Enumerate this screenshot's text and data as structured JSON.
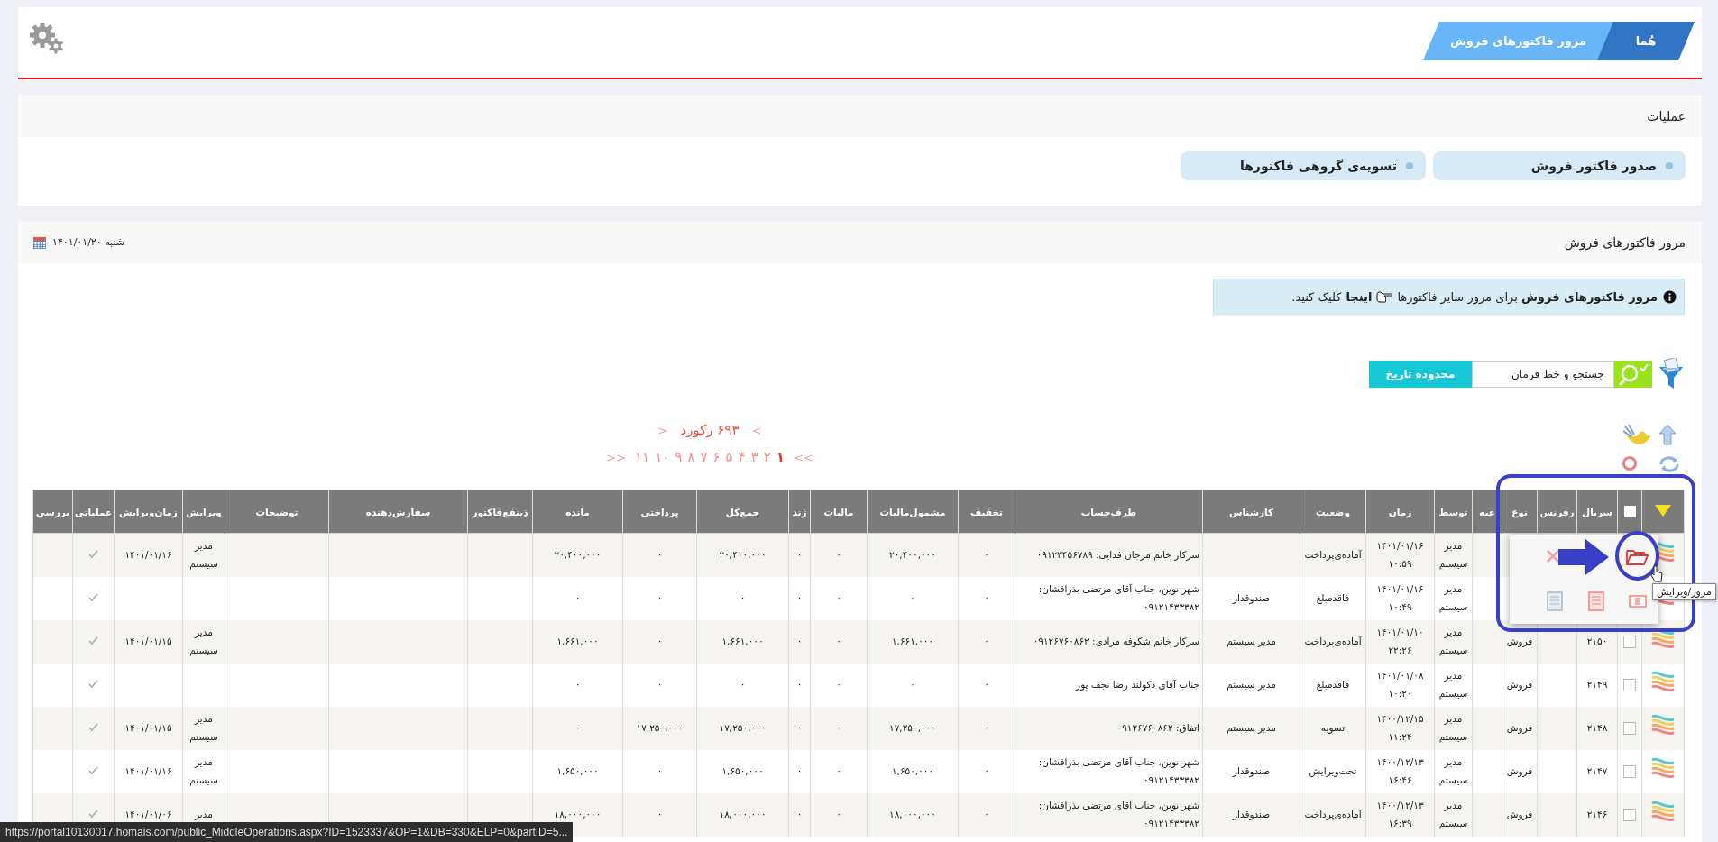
{
  "breadcrumb": [
    {
      "label": "هُما",
      "kind": "home"
    },
    {
      "label": "مرور فاکتورهای فروش",
      "kind": "page"
    }
  ],
  "operations": {
    "title": "عملیات",
    "buttons": [
      "صدور فاکتور فروش",
      "تسویه‌ی گروهی فاکتورها"
    ]
  },
  "invoices": {
    "title": "مرور فاکتورهای فروش",
    "date": "شنبه ۱۴۰۱/۰۱/۲۰",
    "notice": {
      "text": "**مرور فاکتورهای فروش** برای مرور سایر فاکتورها",
      "link": "اینجا",
      "tail": "کلیک کنید."
    },
    "search": {
      "placeholder": "جستجو و خط فرمان"
    },
    "date_range_button": "محدوده تاریخ",
    "record_count": "۶۹۳ رکورد",
    "record_prev": ">",
    "record_next": "<",
    "page_first": ">>",
    "page_last": "<<",
    "pages": [
      {
        "label": "۱",
        "selected": true
      },
      {
        "label": "۲",
        "selected": false
      },
      {
        "label": "۳",
        "selected": false
      },
      {
        "label": "۴",
        "selected": false
      },
      {
        "label": "۵",
        "selected": false
      },
      {
        "label": "۶",
        "selected": false
      },
      {
        "label": "۷",
        "selected": false
      },
      {
        "label": "۸",
        "selected": false
      },
      {
        "label": "۹",
        "selected": false
      },
      {
        "label": "۱۰",
        "selected": false
      },
      {
        "label": "۱۱",
        "selected": false
      }
    ],
    "table": {
      "select_all_checked": false,
      "columns": [
        "سریال",
        "رفرنس",
        "نوع",
        "عبه",
        "توسط",
        "زمان",
        "وضعیت",
        "کارشناس",
        "طرف‌حساب",
        "تخفیف",
        "مشمول‌مالیات",
        "مالیات",
        "ژند",
        "جمع‌کل",
        "پرداختی",
        "مانده",
        "ذینفع‌فاکتور",
        "سفارش‌دهنده",
        "توضیحات",
        "ویرایش",
        "زمان‌ویرایش",
        "عملیاتی",
        "بررسی"
      ],
      "rows": [
        {
          "by": "مدیر سیستم",
          "time": "۱۴۰۱/۰۱/۱۶ ۱۰:۵۹",
          "status": "آماده‌ی‌پرداخت",
          "account": "سرکار خانم مرجان فدایی: ۰۹۱۲۳۴۵۶۷۸۹",
          "discount": "۰",
          "taxable": "۲۰,۴۰۰,۰۰۰",
          "tax": "۰",
          "zend": "۰",
          "total": "۲۰,۴۰۰,۰۰۰",
          "paid": "۰",
          "remaining": "۲۰,۴۰۰,۰۰۰",
          "editor": "مدیر سیستم",
          "edit_time": "۱۴۰۱/۰۱/۱۶",
          "operational": true
        },
        {
          "by": "مدیر سیستم",
          "time": "۱۴۰۱/۰۱/۱۶ ۱۰:۴۹",
          "status": "فاقدمبلغ",
          "expert": "صندوقدار",
          "account": "شهر نوین، جناب آقای مرتضی بذرافشان: ۰۹۱۲۱۴۳۳۳۸۲",
          "discount": "۰",
          "taxable": "۰",
          "tax": "۰",
          "zend": "۰",
          "total": "۰",
          "paid": "۰",
          "remaining": "۰",
          "operational": true
        },
        {
          "checked": false,
          "serial": "۲۱۵۰",
          "type": "فروش",
          "by": "مدیر سیستم",
          "time": "۱۴۰۱/۰۱/۱۰ ۲۲:۲۶",
          "status": "آماده‌ی‌پرداخت",
          "expert": "مدیر سیستم",
          "account": "سرکار خانم شکوفه مرادی: ۰۹۱۲۶۷۶۰۸۶۲",
          "discount": "۰",
          "taxable": "۱,۶۶۱,۰۰۰",
          "tax": "۰",
          "zend": "۰",
          "total": "۱,۶۶۱,۰۰۰",
          "paid": "۰",
          "remaining": "۱,۶۶۱,۰۰۰",
          "editor": "مدیر سیستم",
          "edit_time": "۱۴۰۱/۰۱/۱۵",
          "operational": true
        },
        {
          "checked": false,
          "serial": "۲۱۴۹",
          "type": "فروش",
          "by": "مدیر سیستم",
          "time": "۱۴۰۱/۰۱/۰۸ ۱۰:۲۰",
          "status": "فاقدمبلغ",
          "expert": "مدیر سیستم",
          "account": "جناب آقای دکولند رضا نجف پور",
          "discount": "۰",
          "taxable": "۰",
          "tax": "۰",
          "zend": "۰",
          "total": "۰",
          "paid": "۰",
          "remaining": "۰",
          "operational": true
        },
        {
          "checked": false,
          "serial": "۲۱۴۸",
          "type": "فروش",
          "by": "مدیر سیستم",
          "time": "۱۴۰۰/۱۲/۱۵ ۱۱:۲۴",
          "status": "تسویه",
          "expert": "مدیر سیستم",
          "account": "اتفاق: ۰۹۱۲۶۷۶۰۸۶۲",
          "discount": "۰",
          "taxable": "۱۷,۲۵۰,۰۰۰",
          "tax": "۰",
          "zend": "۰",
          "total": "۱۷,۲۵۰,۰۰۰",
          "paid": "۱۷,۲۵۰,۰۰۰",
          "remaining": "۰",
          "editor": "مدیر سیستم",
          "edit_time": "۱۴۰۱/۰۱/۱۵",
          "operational": true
        },
        {
          "checked": false,
          "serial": "۲۱۴۷",
          "type": "فروش",
          "by": "مدیر سیستم",
          "time": "۱۴۰۰/۱۲/۱۳ ۱۶:۴۶",
          "status": "تحت‌ویرایش",
          "expert": "صندوقدار",
          "account": "شهر نوین، جناب آقای مرتضی بذرافشان: ۰۹۱۲۱۴۳۳۳۸۲",
          "discount": "۰",
          "taxable": "۱,۶۵۰,۰۰۰",
          "tax": "۰",
          "zend": "۰",
          "total": "۱,۶۵۰,۰۰۰",
          "paid": "۰",
          "remaining": "۱,۶۵۰,۰۰۰",
          "editor": "مدیر سیستم",
          "edit_time": "۱۴۰۱/۰۱/۱۶",
          "operational": true
        },
        {
          "checked": false,
          "serial": "۲۱۴۶",
          "type": "فروش",
          "by": "مدیر سیستم",
          "time": "۱۴۰۰/۱۲/۱۳ ۱۶:۳۹",
          "status": "آماده‌ی‌پرداخت",
          "expert": "صندوقدار",
          "account": "شهر نوین، جناب آقای مرتضی بذرافشان: ۰۹۱۲۱۴۳۳۳۸۲",
          "discount": "۰",
          "taxable": "۱۸,۰۰۰,۰۰۰",
          "tax": "۰",
          "zend": "۰",
          "total": "۱۸,۰۰۰,۰۰۰",
          "paid": "۰",
          "remaining": "۱۸,۰۰۰,۰۰۰",
          "editor": "مدیر",
          "edit_time": "۱۴۰۱/۰۱/۰۶",
          "operational": true
        }
      ]
    },
    "popup": {
      "tooltip": "مرور/ویرایش"
    }
  },
  "status_bar": "https://portal10130017.homais.com/public_MiddleOperations.aspx?ID=1523337&OP=1&DB=330&ELP=0&partID=5..."
}
